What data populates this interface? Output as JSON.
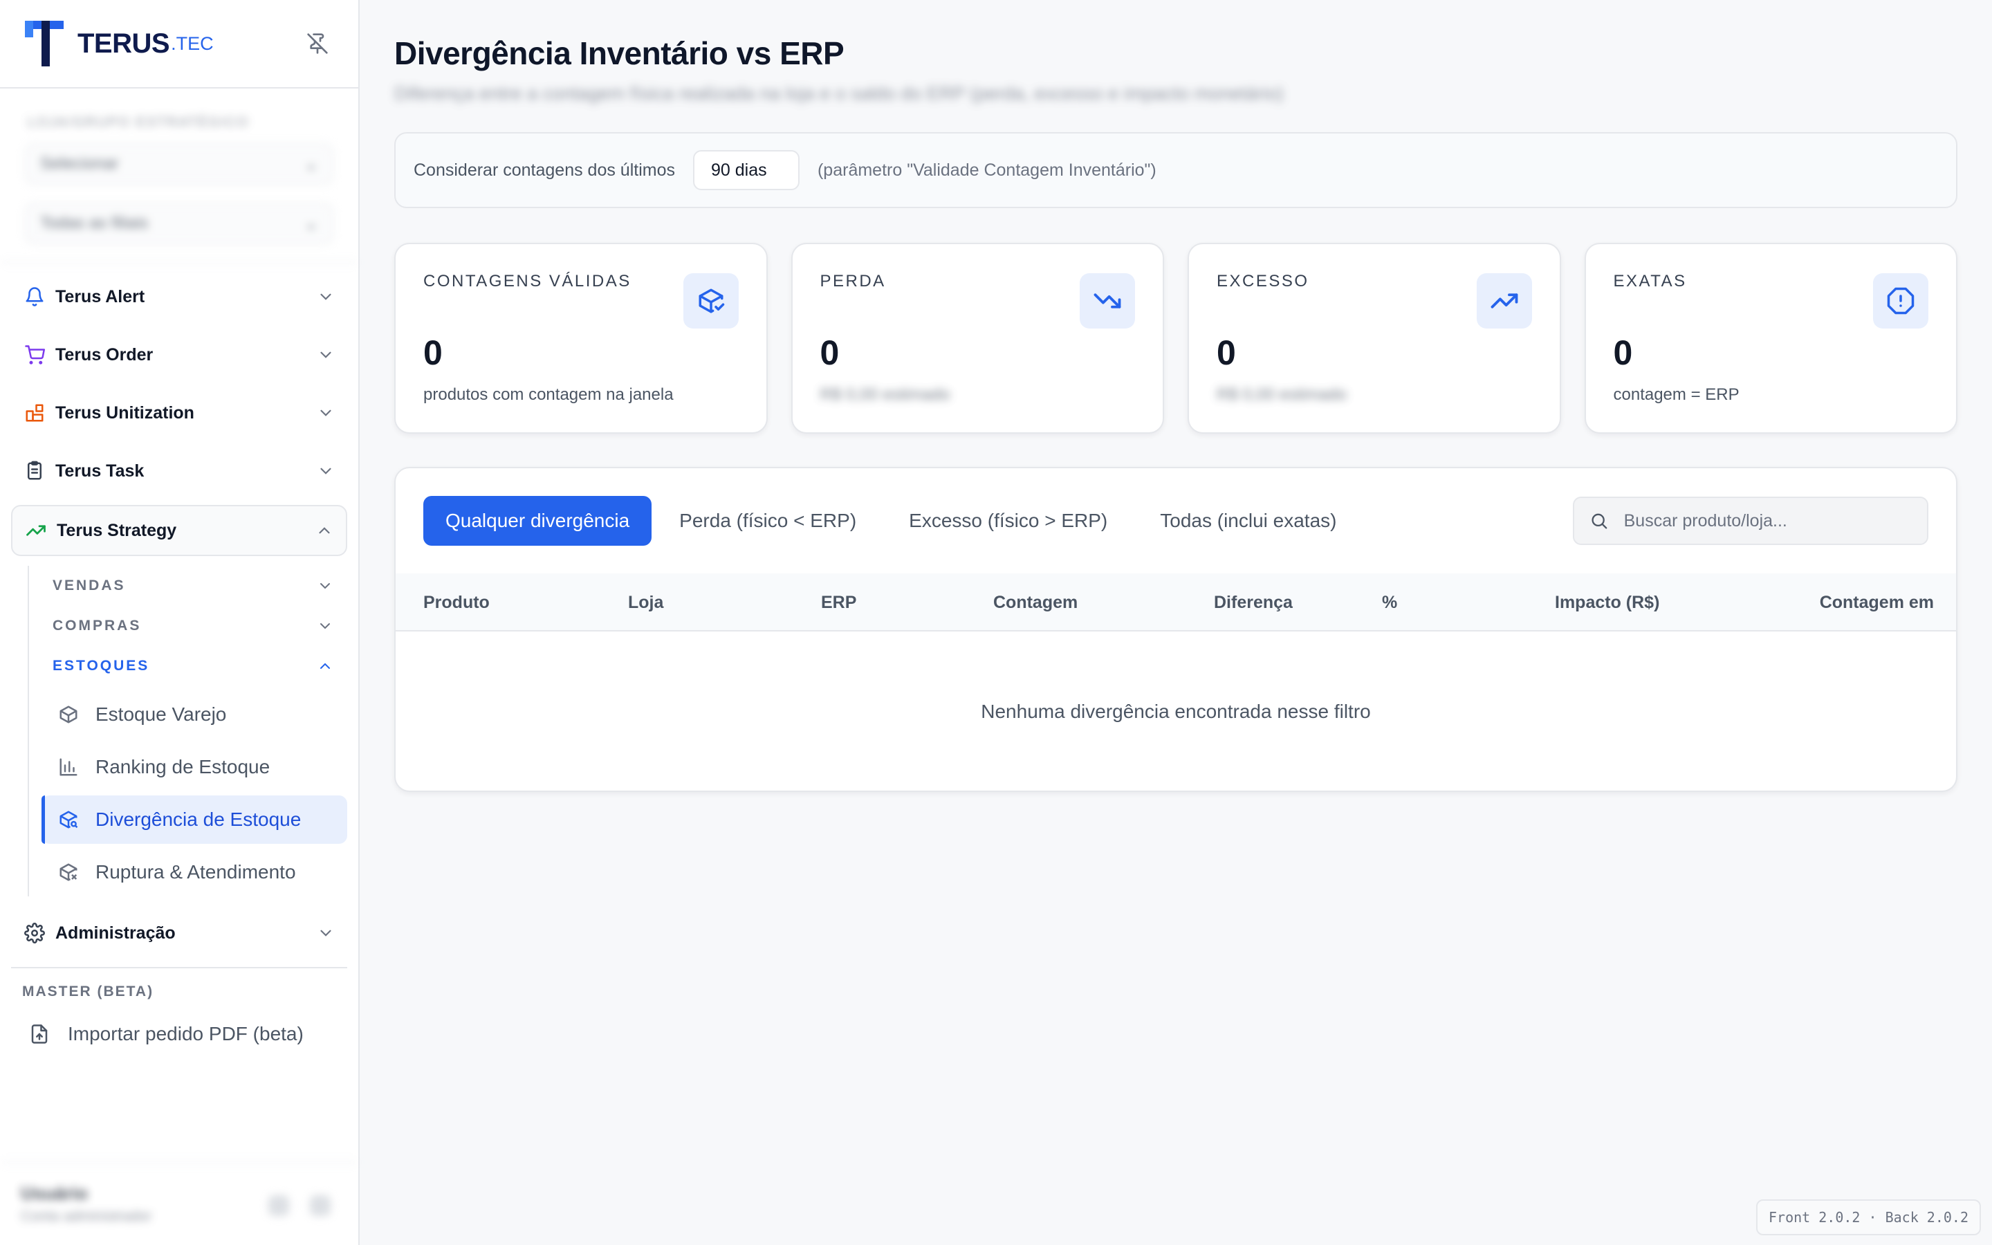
{
  "brand": {
    "name": "TERUS",
    "suffix": ".TEC"
  },
  "sidebar": {
    "filters_label": "LOJA/GRUPO ESTRATÉGICO",
    "filter_store": "Selecionar",
    "filter_all": "Todas as filiais",
    "nav": [
      {
        "label": "Terus Alert"
      },
      {
        "label": "Terus Order"
      },
      {
        "label": "Terus Unitization"
      },
      {
        "label": "Terus Task"
      },
      {
        "label": "Terus Strategy"
      }
    ],
    "sections": {
      "vendas": "VENDAS",
      "compras": "COMPRAS",
      "estoques": "ESTOQUES"
    },
    "leaves": {
      "estoque_varejo": "Estoque Varejo",
      "ranking": "Ranking de Estoque",
      "divergencia": "Divergência de Estoque",
      "ruptura": "Ruptura & Atendimento"
    },
    "admin": "Administração",
    "master_label": "MASTER (BETA)",
    "master_item": "Importar pedido PDF (beta)",
    "user": {
      "name": "Usuário",
      "role": "Conta administrador"
    }
  },
  "page": {
    "title": "Divergência Inventário vs ERP",
    "subtitle": "Diferença entre a contagem física realizada na loja e o saldo do ERP (perda, excesso e impacto monetário)"
  },
  "param": {
    "label": "Considerar contagens dos últimos",
    "value": "90 dias",
    "hint": "(parâmetro \"Validade Contagem Inventário\")"
  },
  "cards": [
    {
      "label": "CONTAGENS VÁLIDAS",
      "value": "0",
      "caption": "produtos com contagem na janela",
      "icon": "package-check-icon"
    },
    {
      "label": "PERDA",
      "value": "0",
      "caption": "R$ 0,00 estimado",
      "icon": "trending-down-icon"
    },
    {
      "label": "EXCESSO",
      "value": "0",
      "caption": "R$ 0,00 estimado",
      "icon": "trending-up-icon"
    },
    {
      "label": "EXATAS",
      "value": "0",
      "caption": "contagem = ERP",
      "icon": "alert-octagon-icon"
    }
  ],
  "tabs": [
    "Qualquer divergência",
    "Perda (físico < ERP)",
    "Excesso (físico > ERP)",
    "Todas (inclui exatas)"
  ],
  "search": {
    "placeholder": "Buscar produto/loja..."
  },
  "table": {
    "columns": [
      "Produto",
      "Loja",
      "ERP",
      "Contagem",
      "Diferença",
      "%",
      "Impacto (R$)",
      "Contagem em"
    ],
    "empty": "Nenhuma divergência encontrada nesse filtro"
  },
  "version": "Front 2.0.2 · Back 2.0.2",
  "colors": {
    "accent": "#2563eb",
    "accent_soft": "#e8effd",
    "strategy_green": "#16a34a",
    "order_purple": "#7c3aed",
    "unitization_orange": "#ea580c"
  }
}
